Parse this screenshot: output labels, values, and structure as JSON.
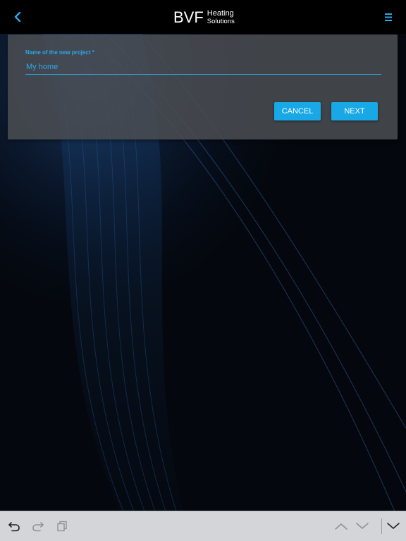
{
  "header": {
    "logo_mark": "BVF",
    "logo_line1": "Heating",
    "logo_line2": "Solutions"
  },
  "form": {
    "field_label": "Name of the new project *",
    "field_value": "My home",
    "cancel_label": "CANCEL",
    "next_label": "NEXT"
  },
  "icons": {
    "back": "chevron-left-icon",
    "menu": "hamburger-menu-icon",
    "undo": "undo-icon",
    "redo": "redo-icon",
    "paste": "paste-icon",
    "prev": "chevron-up-icon",
    "next": "chevron-down-icon",
    "dismiss": "keyboard-dismiss-icon"
  },
  "colors": {
    "accent": "#18a8e6",
    "bar": "#000000",
    "card": "#4a4d52",
    "background": "#05080f",
    "keyboard_bar": "#d3d5d9"
  }
}
